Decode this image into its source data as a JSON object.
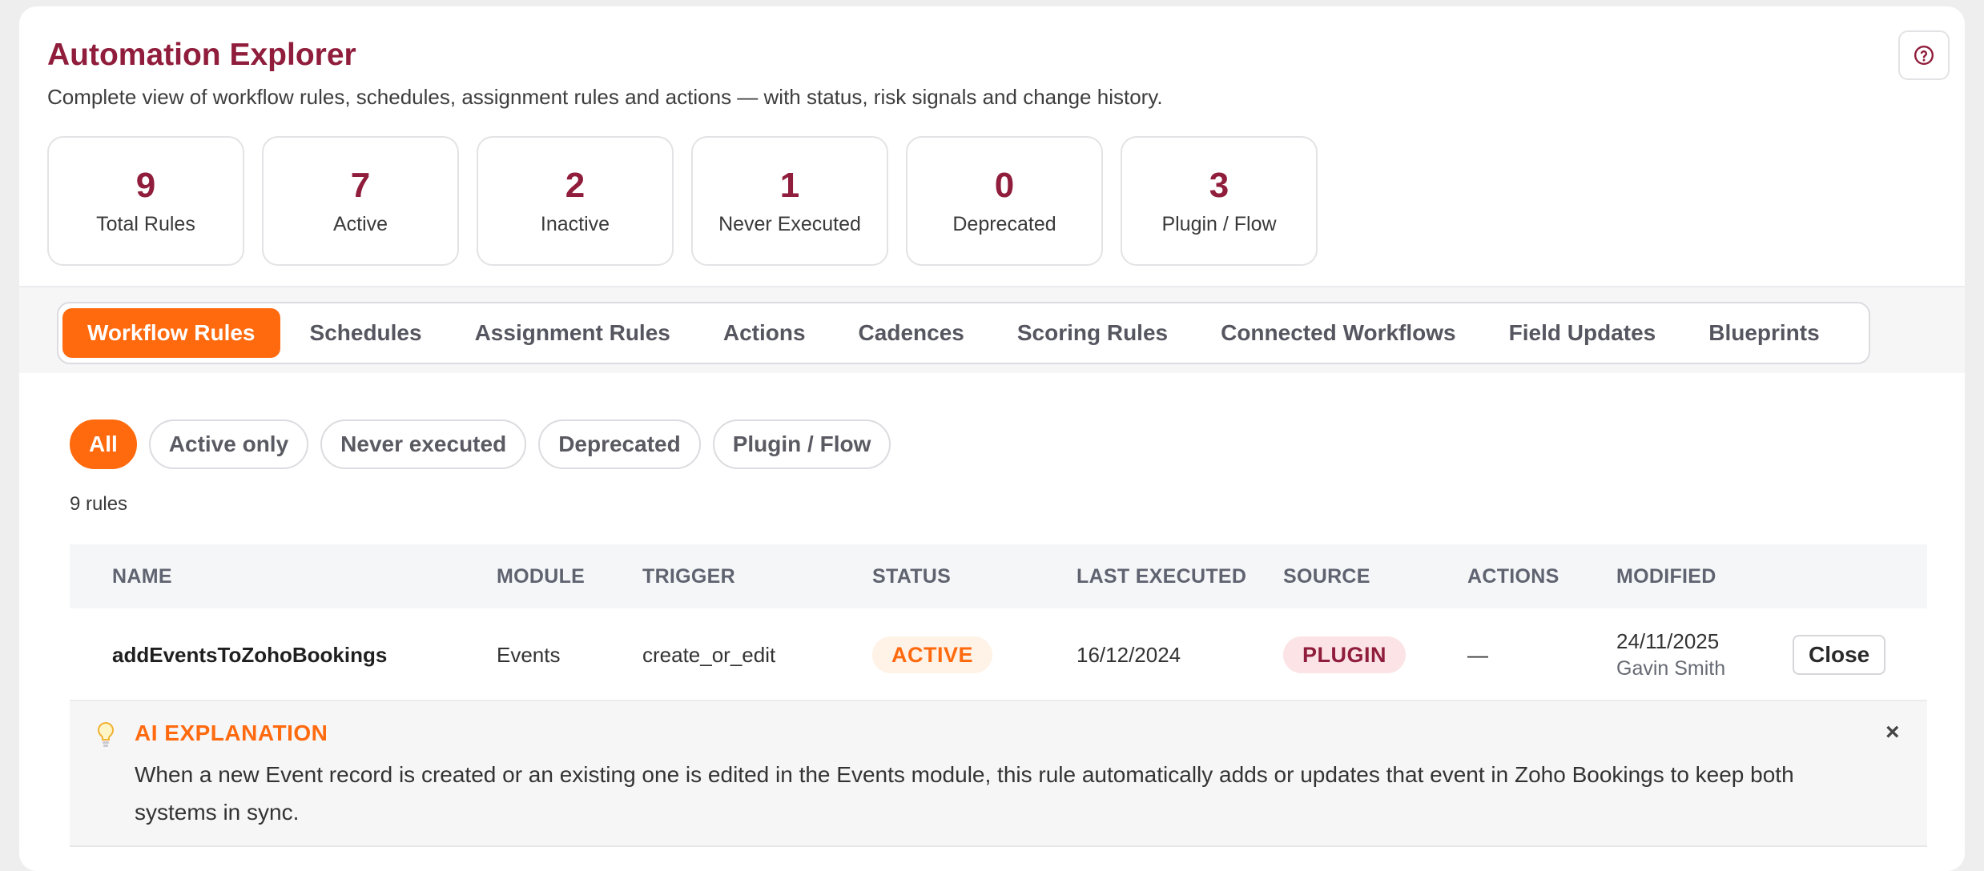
{
  "header": {
    "title": "Automation Explorer",
    "subtitle": "Complete view of workflow rules, schedules, assignment rules and actions — with status, risk signals and change history."
  },
  "stats": [
    {
      "value": "9",
      "label": "Total Rules"
    },
    {
      "value": "7",
      "label": "Active"
    },
    {
      "value": "2",
      "label": "Inactive"
    },
    {
      "value": "1",
      "label": "Never Executed"
    },
    {
      "value": "0",
      "label": "Deprecated"
    },
    {
      "value": "3",
      "label": "Plugin / Flow"
    }
  ],
  "tabs": [
    {
      "label": "Workflow Rules",
      "active": true
    },
    {
      "label": "Schedules"
    },
    {
      "label": "Assignment Rules"
    },
    {
      "label": "Actions"
    },
    {
      "label": "Cadences"
    },
    {
      "label": "Scoring Rules"
    },
    {
      "label": "Connected Workflows"
    },
    {
      "label": "Field Updates"
    },
    {
      "label": "Blueprints"
    }
  ],
  "filters": [
    {
      "label": "All",
      "active": true
    },
    {
      "label": "Active only"
    },
    {
      "label": "Never executed"
    },
    {
      "label": "Deprecated"
    },
    {
      "label": "Plugin / Flow"
    }
  ],
  "rule_count": "9 rules",
  "table": {
    "headers": [
      "NAME",
      "MODULE",
      "TRIGGER",
      "STATUS",
      "LAST EXECUTED",
      "SOURCE",
      "ACTIONS",
      "MODIFIED"
    ],
    "rows": [
      {
        "name": "addEventsToZohoBookings",
        "module": "Events",
        "trigger": "create_or_edit",
        "status": "ACTIVE",
        "last_executed": "16/12/2024",
        "source": "PLUGIN",
        "actions": "—",
        "modified_date": "24/11/2025",
        "modified_by": "Gavin Smith",
        "close_label": "Close"
      }
    ]
  },
  "ai_explanation": {
    "title": "AI EXPLANATION",
    "text": "When a new Event record is created or an existing one is edited in the Events module, this rule automatically adds or updates that event in Zoho Bookings to keep both systems in sync.",
    "close_symbol": "×"
  },
  "icons": {
    "help": "help-circle-icon",
    "ai": "lightbulb-icon"
  },
  "colors": {
    "brand": "#8f1d3b",
    "accent": "#ff6a0f"
  }
}
